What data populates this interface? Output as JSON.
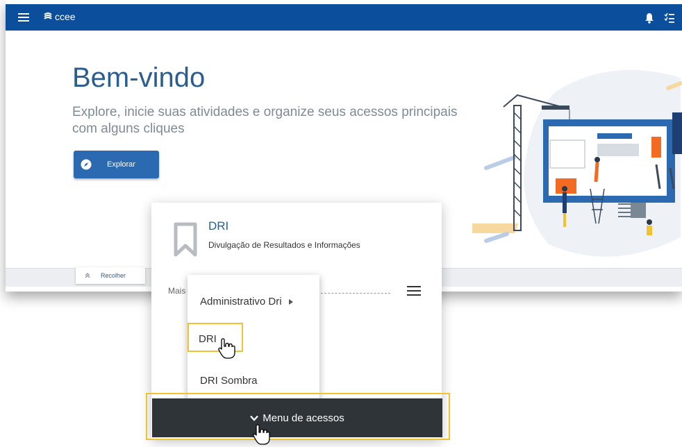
{
  "topbar": {
    "brand": "ccee",
    "menu_icon": "hamburger-menu-icon",
    "notifications_icon": "bell-icon",
    "tasks_icon": "checklist-icon",
    "background": "#0b4f9c"
  },
  "hero": {
    "title": "Bem-vindo",
    "subtitle": "Explore, inicie suas atividades e organize seus acessos principais com alguns cliques",
    "explore_button": "Explorar",
    "explore_icon": "compass-icon",
    "collapse_button": "Recolher",
    "collapse_icon": "double-chevron-up-icon"
  },
  "card": {
    "title": "DRI",
    "description": "Divulgação de Resultados e Informações",
    "more_label": "Mais",
    "icon": "bookmark-icon",
    "menu_icon": "hamburger-menu-icon"
  },
  "dropdown": {
    "items": [
      {
        "label": "Administrativo Dri",
        "has_submenu": true
      },
      {
        "label": "DRI",
        "highlighted": true
      },
      {
        "label": "DRI Sombra"
      }
    ]
  },
  "access_menu": {
    "label": "Menu de acessos",
    "icon": "chevron-down-icon"
  },
  "colors": {
    "accent": "#2b6ab1",
    "highlight": "#f2c230",
    "dark_bar": "#2f3439"
  }
}
